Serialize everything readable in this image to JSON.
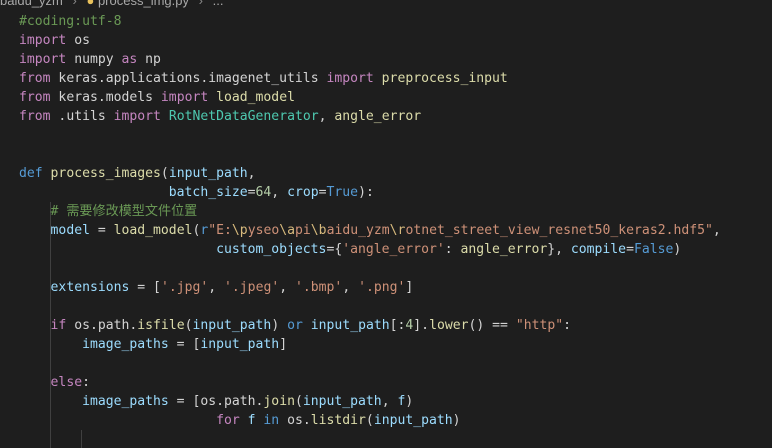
{
  "breadcrumb": {
    "folder": "baidu_yzm",
    "file": "process_img.py",
    "trail": "..."
  },
  "editor": {
    "language": "python",
    "lines": [
      {
        "tokens": [
          {
            "t": "#coding:utf-8",
            "c": "cm"
          }
        ]
      },
      {
        "tokens": [
          {
            "t": "import",
            "c": "ctl"
          },
          {
            "t": " os",
            "c": "plain"
          }
        ]
      },
      {
        "tokens": [
          {
            "t": "import",
            "c": "ctl"
          },
          {
            "t": " numpy ",
            "c": "plain"
          },
          {
            "t": "as",
            "c": "ctl"
          },
          {
            "t": " np",
            "c": "plain"
          }
        ]
      },
      {
        "tokens": [
          {
            "t": "from",
            "c": "ctl"
          },
          {
            "t": " keras.applications.imagenet_utils ",
            "c": "plain"
          },
          {
            "t": "import",
            "c": "ctl"
          },
          {
            "t": " ",
            "c": "plain"
          },
          {
            "t": "preprocess_input",
            "c": "fn"
          }
        ]
      },
      {
        "tokens": [
          {
            "t": "from",
            "c": "ctl"
          },
          {
            "t": " keras.models ",
            "c": "plain"
          },
          {
            "t": "import",
            "c": "ctl"
          },
          {
            "t": " ",
            "c": "plain"
          },
          {
            "t": "load_model",
            "c": "fn"
          }
        ]
      },
      {
        "tokens": [
          {
            "t": "from",
            "c": "ctl"
          },
          {
            "t": " .utils ",
            "c": "plain"
          },
          {
            "t": "import",
            "c": "ctl"
          },
          {
            "t": " ",
            "c": "plain"
          },
          {
            "t": "RotNetDataGenerator",
            "c": "cls"
          },
          {
            "t": ", ",
            "c": "plain"
          },
          {
            "t": "angle_error",
            "c": "fn"
          }
        ]
      },
      {
        "tokens": []
      },
      {
        "tokens": []
      },
      {
        "tokens": [
          {
            "t": "def",
            "c": "kw"
          },
          {
            "t": " ",
            "c": "plain"
          },
          {
            "t": "process_images",
            "c": "fn"
          },
          {
            "t": "(",
            "c": "plain"
          },
          {
            "t": "input_path",
            "c": "var"
          },
          {
            "t": ",",
            "c": "plain"
          }
        ]
      },
      {
        "tokens": [
          {
            "t": "                   ",
            "c": "plain"
          },
          {
            "t": "batch_size",
            "c": "var"
          },
          {
            "t": "=",
            "c": "plain"
          },
          {
            "t": "64",
            "c": "num"
          },
          {
            "t": ", ",
            "c": "plain"
          },
          {
            "t": "crop",
            "c": "var"
          },
          {
            "t": "=",
            "c": "plain"
          },
          {
            "t": "True",
            "c": "kw"
          },
          {
            "t": "):",
            "c": "plain"
          }
        ]
      },
      {
        "tokens": [
          {
            "t": "    ",
            "c": "plain"
          },
          {
            "t": "# 需要修改模型文件位置",
            "c": "cm"
          }
        ]
      },
      {
        "tokens": [
          {
            "t": "    ",
            "c": "plain"
          },
          {
            "t": "model",
            "c": "var"
          },
          {
            "t": " = ",
            "c": "plain"
          },
          {
            "t": "load_model",
            "c": "fn"
          },
          {
            "t": "(",
            "c": "plain"
          },
          {
            "t": "r",
            "c": "kw"
          },
          {
            "t": "\"E:",
            "c": "str"
          },
          {
            "t": "\\p",
            "c": "esc"
          },
          {
            "t": "yseo",
            "c": "str"
          },
          {
            "t": "\\a",
            "c": "esc"
          },
          {
            "t": "pi",
            "c": "str"
          },
          {
            "t": "\\b",
            "c": "esc"
          },
          {
            "t": "aidu_yzm",
            "c": "str"
          },
          {
            "t": "\\r",
            "c": "esc"
          },
          {
            "t": "otnet_street_view_resnet50_keras2.hdf5\"",
            "c": "str"
          },
          {
            "t": ",",
            "c": "plain"
          }
        ]
      },
      {
        "tokens": [
          {
            "t": "                         ",
            "c": "plain"
          },
          {
            "t": "custom_objects",
            "c": "var"
          },
          {
            "t": "={",
            "c": "plain"
          },
          {
            "t": "'angle_error'",
            "c": "str"
          },
          {
            "t": ": ",
            "c": "plain"
          },
          {
            "t": "angle_error",
            "c": "fn"
          },
          {
            "t": "}, ",
            "c": "plain"
          },
          {
            "t": "compile",
            "c": "var"
          },
          {
            "t": "=",
            "c": "plain"
          },
          {
            "t": "False",
            "c": "kw"
          },
          {
            "t": ")",
            "c": "plain"
          }
        ]
      },
      {
        "tokens": []
      },
      {
        "tokens": [
          {
            "t": "    ",
            "c": "plain"
          },
          {
            "t": "extensions",
            "c": "var"
          },
          {
            "t": " = [",
            "c": "plain"
          },
          {
            "t": "'.jpg'",
            "c": "str"
          },
          {
            "t": ", ",
            "c": "plain"
          },
          {
            "t": "'.jpeg'",
            "c": "str"
          },
          {
            "t": ", ",
            "c": "plain"
          },
          {
            "t": "'.bmp'",
            "c": "str"
          },
          {
            "t": ", ",
            "c": "plain"
          },
          {
            "t": "'.png'",
            "c": "str"
          },
          {
            "t": "]",
            "c": "plain"
          }
        ]
      },
      {
        "tokens": []
      },
      {
        "tokens": [
          {
            "t": "    ",
            "c": "plain"
          },
          {
            "t": "if",
            "c": "ctl"
          },
          {
            "t": " os.path.",
            "c": "plain"
          },
          {
            "t": "isfile",
            "c": "fn"
          },
          {
            "t": "(",
            "c": "plain"
          },
          {
            "t": "input_path",
            "c": "var"
          },
          {
            "t": ") ",
            "c": "plain"
          },
          {
            "t": "or",
            "c": "kw"
          },
          {
            "t": " ",
            "c": "plain"
          },
          {
            "t": "input_path",
            "c": "var"
          },
          {
            "t": "[:",
            "c": "plain"
          },
          {
            "t": "4",
            "c": "num"
          },
          {
            "t": "].",
            "c": "plain"
          },
          {
            "t": "lower",
            "c": "fn"
          },
          {
            "t": "() == ",
            "c": "plain"
          },
          {
            "t": "\"http\"",
            "c": "str"
          },
          {
            "t": ":",
            "c": "plain"
          }
        ]
      },
      {
        "tokens": [
          {
            "t": "        ",
            "c": "plain"
          },
          {
            "t": "image_paths",
            "c": "var"
          },
          {
            "t": " = [",
            "c": "plain"
          },
          {
            "t": "input_path",
            "c": "var"
          },
          {
            "t": "]",
            "c": "plain"
          }
        ]
      },
      {
        "tokens": []
      },
      {
        "tokens": [
          {
            "t": "    ",
            "c": "plain"
          },
          {
            "t": "else",
            "c": "ctl"
          },
          {
            "t": ":",
            "c": "plain"
          }
        ]
      },
      {
        "tokens": [
          {
            "t": "        ",
            "c": "plain"
          },
          {
            "t": "image_paths",
            "c": "var"
          },
          {
            "t": " = [",
            "c": "plain"
          },
          {
            "t": "os.path.",
            "c": "plain"
          },
          {
            "t": "join",
            "c": "fn"
          },
          {
            "t": "(",
            "c": "plain"
          },
          {
            "t": "input_path",
            "c": "var"
          },
          {
            "t": ", ",
            "c": "plain"
          },
          {
            "t": "f",
            "c": "var"
          },
          {
            "t": ")",
            "c": "plain"
          }
        ]
      },
      {
        "tokens": [
          {
            "t": "                         ",
            "c": "plain"
          },
          {
            "t": "for",
            "c": "ctl"
          },
          {
            "t": " ",
            "c": "plain"
          },
          {
            "t": "f",
            "c": "var"
          },
          {
            "t": " ",
            "c": "plain"
          },
          {
            "t": "in",
            "c": "kw"
          },
          {
            "t": " os.",
            "c": "plain"
          },
          {
            "t": "listdir",
            "c": "fn"
          },
          {
            "t": "(",
            "c": "plain"
          },
          {
            "t": "input_path",
            "c": "var"
          },
          {
            "t": ")",
            "c": "plain"
          }
        ]
      }
    ]
  }
}
